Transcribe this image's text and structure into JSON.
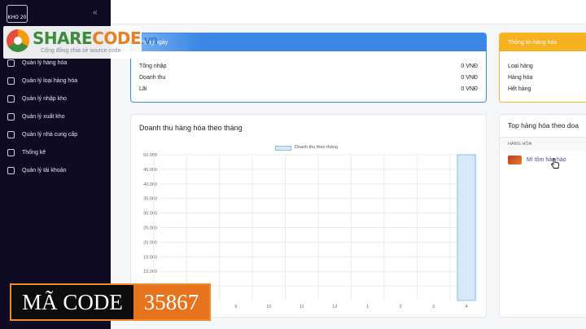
{
  "sidebar": {
    "logo_text": "KHO 20",
    "collapse_icon": "«",
    "items": [
      {
        "label": "Quản lý hàng hóa",
        "icon": "box-icon"
      },
      {
        "label": "Quản lý loại hàng hóa",
        "icon": "layers-icon"
      },
      {
        "label": "Quản lý nhập kho",
        "icon": "import-icon"
      },
      {
        "label": "Quản lý xuất kho",
        "icon": "export-icon"
      },
      {
        "label": "Quản lý nhà cung cấp",
        "icon": "supplier-icon"
      },
      {
        "label": "Thống kê",
        "icon": "stats-icon"
      },
      {
        "label": "Quản lý tài khoản",
        "icon": "account-icon"
      }
    ]
  },
  "watermark": {
    "brand_a": "SHARE",
    "brand_b": "CODE",
    "brand_c": ".vn",
    "tagline": "Cộng đồng chia sẻ source code"
  },
  "today": {
    "title": "Trong ngày",
    "rows": [
      {
        "label": "Tổng nhập",
        "value": "0 VNĐ"
      },
      {
        "label": "Doanh thu",
        "value": "0 VNĐ"
      },
      {
        "label": "Lãi",
        "value": "0 VNĐ"
      }
    ]
  },
  "product_info": {
    "title": "Thông tin hàng hóa",
    "rows": [
      {
        "label": "Loại hàng"
      },
      {
        "label": "Hàng hóa"
      },
      {
        "label": "Hết hàng"
      }
    ]
  },
  "chart_card": {
    "title": "Doanh thu hàng hóa theo tháng"
  },
  "chart_data": {
    "type": "bar",
    "title": "Doanh thu hàng hóa theo tháng",
    "legend": "Doanh thu theo tháng",
    "categories": [
      "7",
      "8",
      "9",
      "10",
      "11",
      "12",
      "1",
      "2",
      "3",
      "4"
    ],
    "series": [
      {
        "name": "Doanh thu theo tháng",
        "values": [
          0,
          0,
          0,
          0,
          0,
          0,
          0,
          0,
          0,
          50000
        ]
      }
    ],
    "yticks": [
      "50.000",
      "45.000",
      "40.000",
      "35.000",
      "30.000",
      "25.000",
      "20.000",
      "15.000",
      "10.000",
      "5.000"
    ],
    "ylim": [
      0,
      50000
    ],
    "grid": true,
    "bar_color": "#d6e9f9",
    "bar_border": "#8cbfe8"
  },
  "top_products": {
    "title": "Top hàng hóa theo doa",
    "column": "HÀNG HÓA",
    "items": [
      {
        "name": "Mì tôm hảo hảo"
      }
    ]
  },
  "code_badge": {
    "label": "MÃ CODE",
    "number": "35867"
  }
}
